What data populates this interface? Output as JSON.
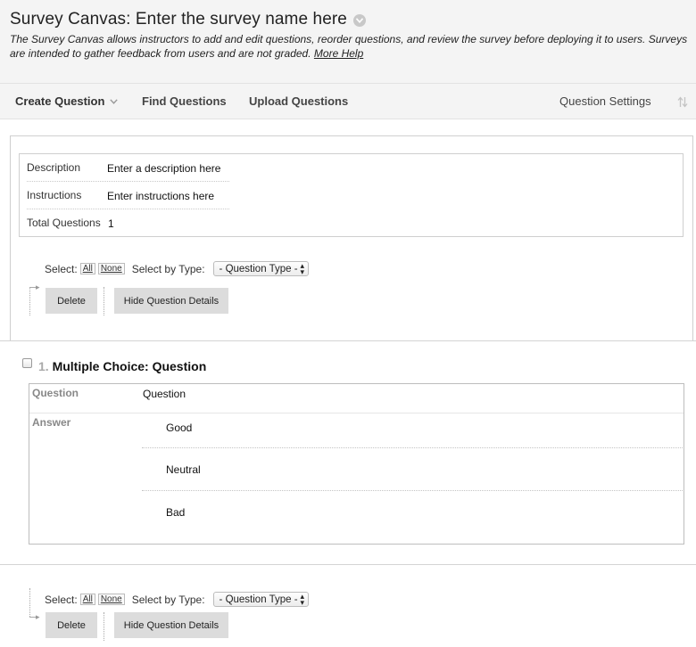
{
  "header": {
    "title": "Survey Canvas: Enter the survey name here",
    "intro": "The Survey Canvas allows instructors to add and edit questions, reorder questions, and review the survey before deploying it to users. Surveys are intended to gather feedback from users and are not graded.",
    "more_help": "More Help"
  },
  "toolbar": {
    "create_question": "Create Question",
    "find_questions": "Find Questions",
    "upload_questions": "Upload Questions",
    "question_settings": "Question Settings"
  },
  "info": {
    "description_label": "Description",
    "description_value": "Enter a description here",
    "instructions_label": "Instructions",
    "instructions_value": "Enter instructions here",
    "total_label": "Total Questions",
    "total_value": "1"
  },
  "selection": {
    "select_label": "Select:",
    "all": "All",
    "none": "None",
    "type_label": "Select by Type:",
    "type_value": "- Question Type -"
  },
  "actions": {
    "delete": "Delete",
    "hide_details": "Hide Question Details"
  },
  "question": {
    "number": "1.",
    "title": "Multiple Choice: Question",
    "question_label": "Question",
    "question_text": "Question",
    "answer_label": "Answer",
    "answers": [
      "Good",
      "Neutral",
      "Bad"
    ]
  }
}
